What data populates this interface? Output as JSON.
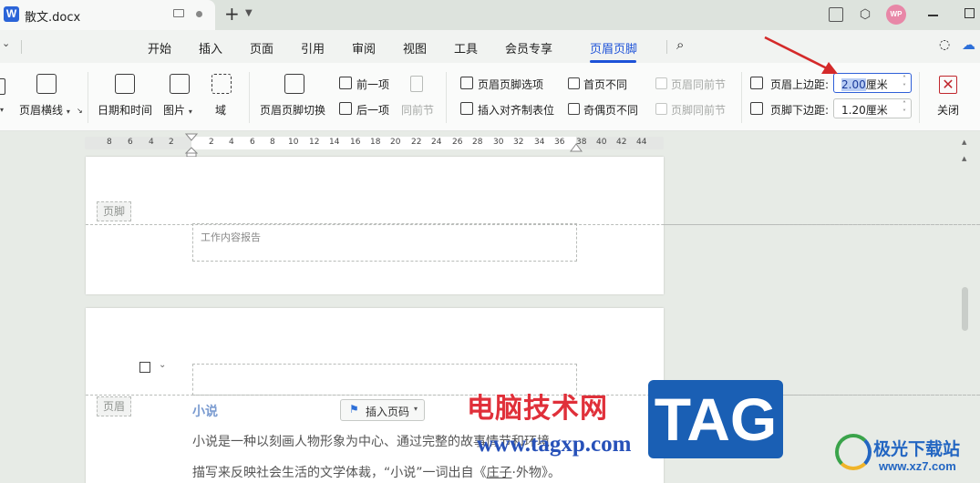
{
  "titlebar": {
    "app_logo": "W",
    "doc_title": "散文.docx",
    "new_tab": "+",
    "avatar_text": "WP",
    "icons": [
      "monitor-icon",
      "dot-icon",
      "sidebar-icon",
      "cube-icon",
      "minimize-icon",
      "maximize-icon"
    ]
  },
  "menu": {
    "items": [
      "开始",
      "插入",
      "页面",
      "引用",
      "审阅",
      "视图",
      "工具",
      "会员专享",
      "页眉页脚"
    ],
    "active": "页眉页脚"
  },
  "ribbon": {
    "header_line": "页眉横线",
    "date_time": "日期和时间",
    "picture": "图片",
    "field": "域",
    "switch": "页眉页脚切换",
    "prev": "前一项",
    "next": "后一项",
    "same_as_prev": "同前节",
    "options": "页眉页脚选项",
    "insert_align_tab": "插入对齐制表位",
    "first_page_diff": "首页不同",
    "odd_even_diff": "奇偶页不同",
    "header_same_prev": "页眉同前节",
    "footer_same_prev": "页脚同前节",
    "header_top_label": "页眉上边距:",
    "header_top_value_selected": "2.00",
    "header_top_unit": "厘米",
    "footer_bottom_label": "页脚下边距:",
    "footer_bottom_value": "1.20厘米",
    "close": "关闭"
  },
  "ruler": {
    "left_numbers": [
      "8",
      "6",
      "4",
      "2"
    ],
    "right_numbers": [
      "2",
      "4",
      "6",
      "8",
      "10",
      "12",
      "14",
      "16",
      "18",
      "20",
      "22",
      "24",
      "26",
      "28",
      "30",
      "32",
      "34",
      "36",
      "38",
      "40",
      "42",
      "44"
    ]
  },
  "page1": {
    "footer_tag": "页脚",
    "footer_text": "工作内容报告"
  },
  "page2": {
    "header_tag": "页眉",
    "insert_page_number": "插入页码",
    "heading": "小说",
    "line1": "小说是一种以刻画人物形象为中心、通过完整的故事情节和环境",
    "line2_a": "描写来反映社会生活的文学体裁，“小说”一词出自《",
    "line2_link": "庄子",
    "line2_b": "·外物》。"
  },
  "watermark": {
    "site_cn": "电脑技术网",
    "site_url": "www.tagxp.com",
    "tag": "TAG",
    "xz_name": "极光下载站",
    "xz_url": "www.xz7.com"
  }
}
